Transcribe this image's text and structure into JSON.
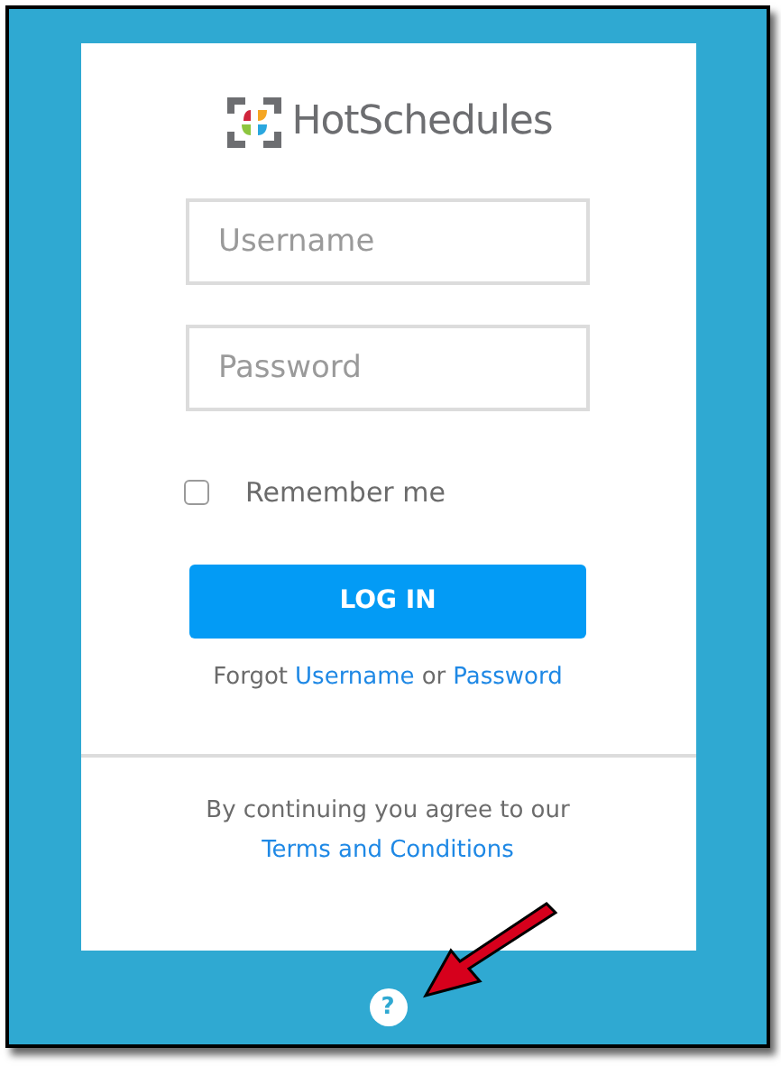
{
  "logo": {
    "text": "HotSchedules"
  },
  "username": {
    "placeholder": "Username"
  },
  "password": {
    "placeholder": "Password"
  },
  "remember": {
    "label": "Remember me",
    "checked": false
  },
  "login_button": "LOG IN",
  "forgot": {
    "prefix": "Forgot",
    "username_link": "Username",
    "joiner": "or",
    "password_link": "Password"
  },
  "terms": {
    "text": "By continuing you agree to our",
    "link": "Terms and Conditions"
  },
  "help": {
    "symbol": "?"
  }
}
